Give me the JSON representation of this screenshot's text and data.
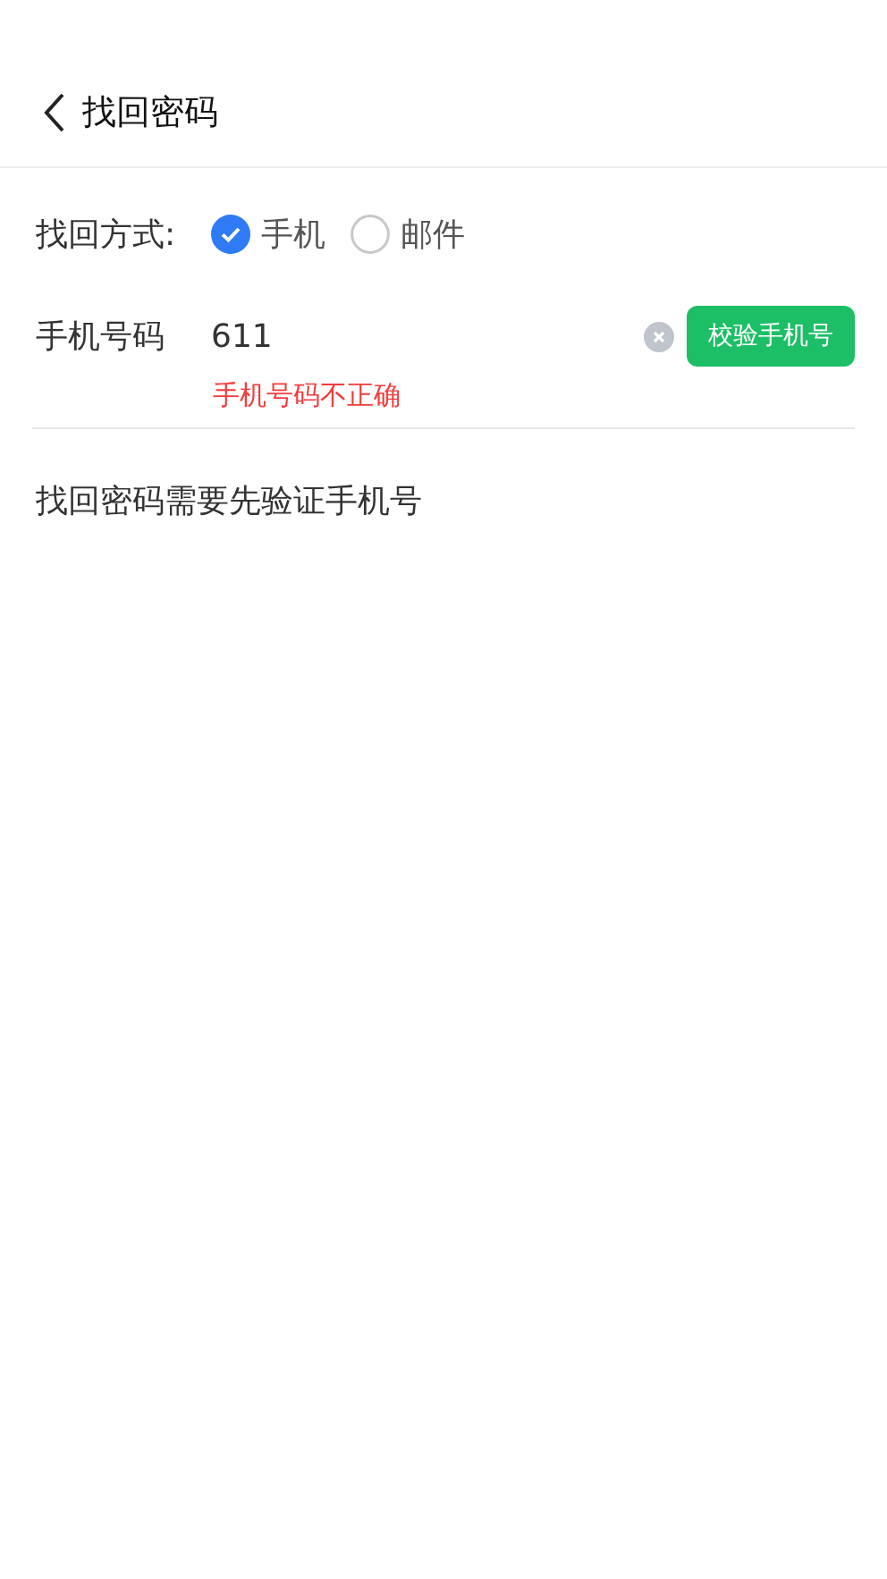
{
  "header": {
    "title": "找回密码"
  },
  "method": {
    "label": "找回方式:",
    "options": [
      {
        "label": "手机",
        "selected": true
      },
      {
        "label": "邮件",
        "selected": false
      }
    ]
  },
  "phone": {
    "label": "手机号码",
    "value": "611",
    "error": "手机号码不正确",
    "button": "校验手机号"
  },
  "hint": "找回密码需要先验证手机号"
}
